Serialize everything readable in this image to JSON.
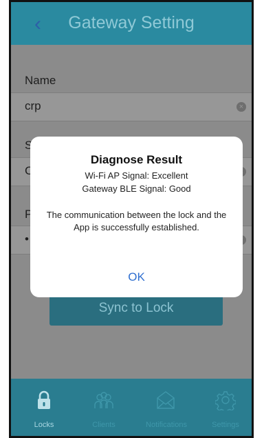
{
  "nav": {
    "back_icon": "chevron-left-icon",
    "back_glyph": "‹",
    "title": "Gateway Setting"
  },
  "form": {
    "name_label": "Name",
    "name_value": "crp",
    "ssid_label_partial": "S",
    "ssid_value_partial": "C",
    "password_label_partial": "P",
    "password_value_partial": "•",
    "clear_glyph": "×"
  },
  "sync_button": "Sync to Lock",
  "dialog": {
    "title": "Diagnose Result",
    "line1": "Wi-Fi AP Signal: Excellent",
    "line2": "Gateway BLE Signal: Good",
    "message": "The communication between the lock and the App is successfully established.",
    "ok": "OK"
  },
  "tabs": [
    {
      "label": "Locks",
      "icon": "lock-icon",
      "active": true
    },
    {
      "label": "Clients",
      "icon": "people-icon",
      "active": false
    },
    {
      "label": "Notifications",
      "icon": "envelope-icon",
      "active": false
    },
    {
      "label": "Settings",
      "icon": "gear-icon",
      "active": false
    }
  ],
  "colors": {
    "nav": "#2a8aa0",
    "tabbar": "#2a7d90",
    "ok_text": "#2f6fd0",
    "overlay_bg": "#8b8b8b"
  }
}
